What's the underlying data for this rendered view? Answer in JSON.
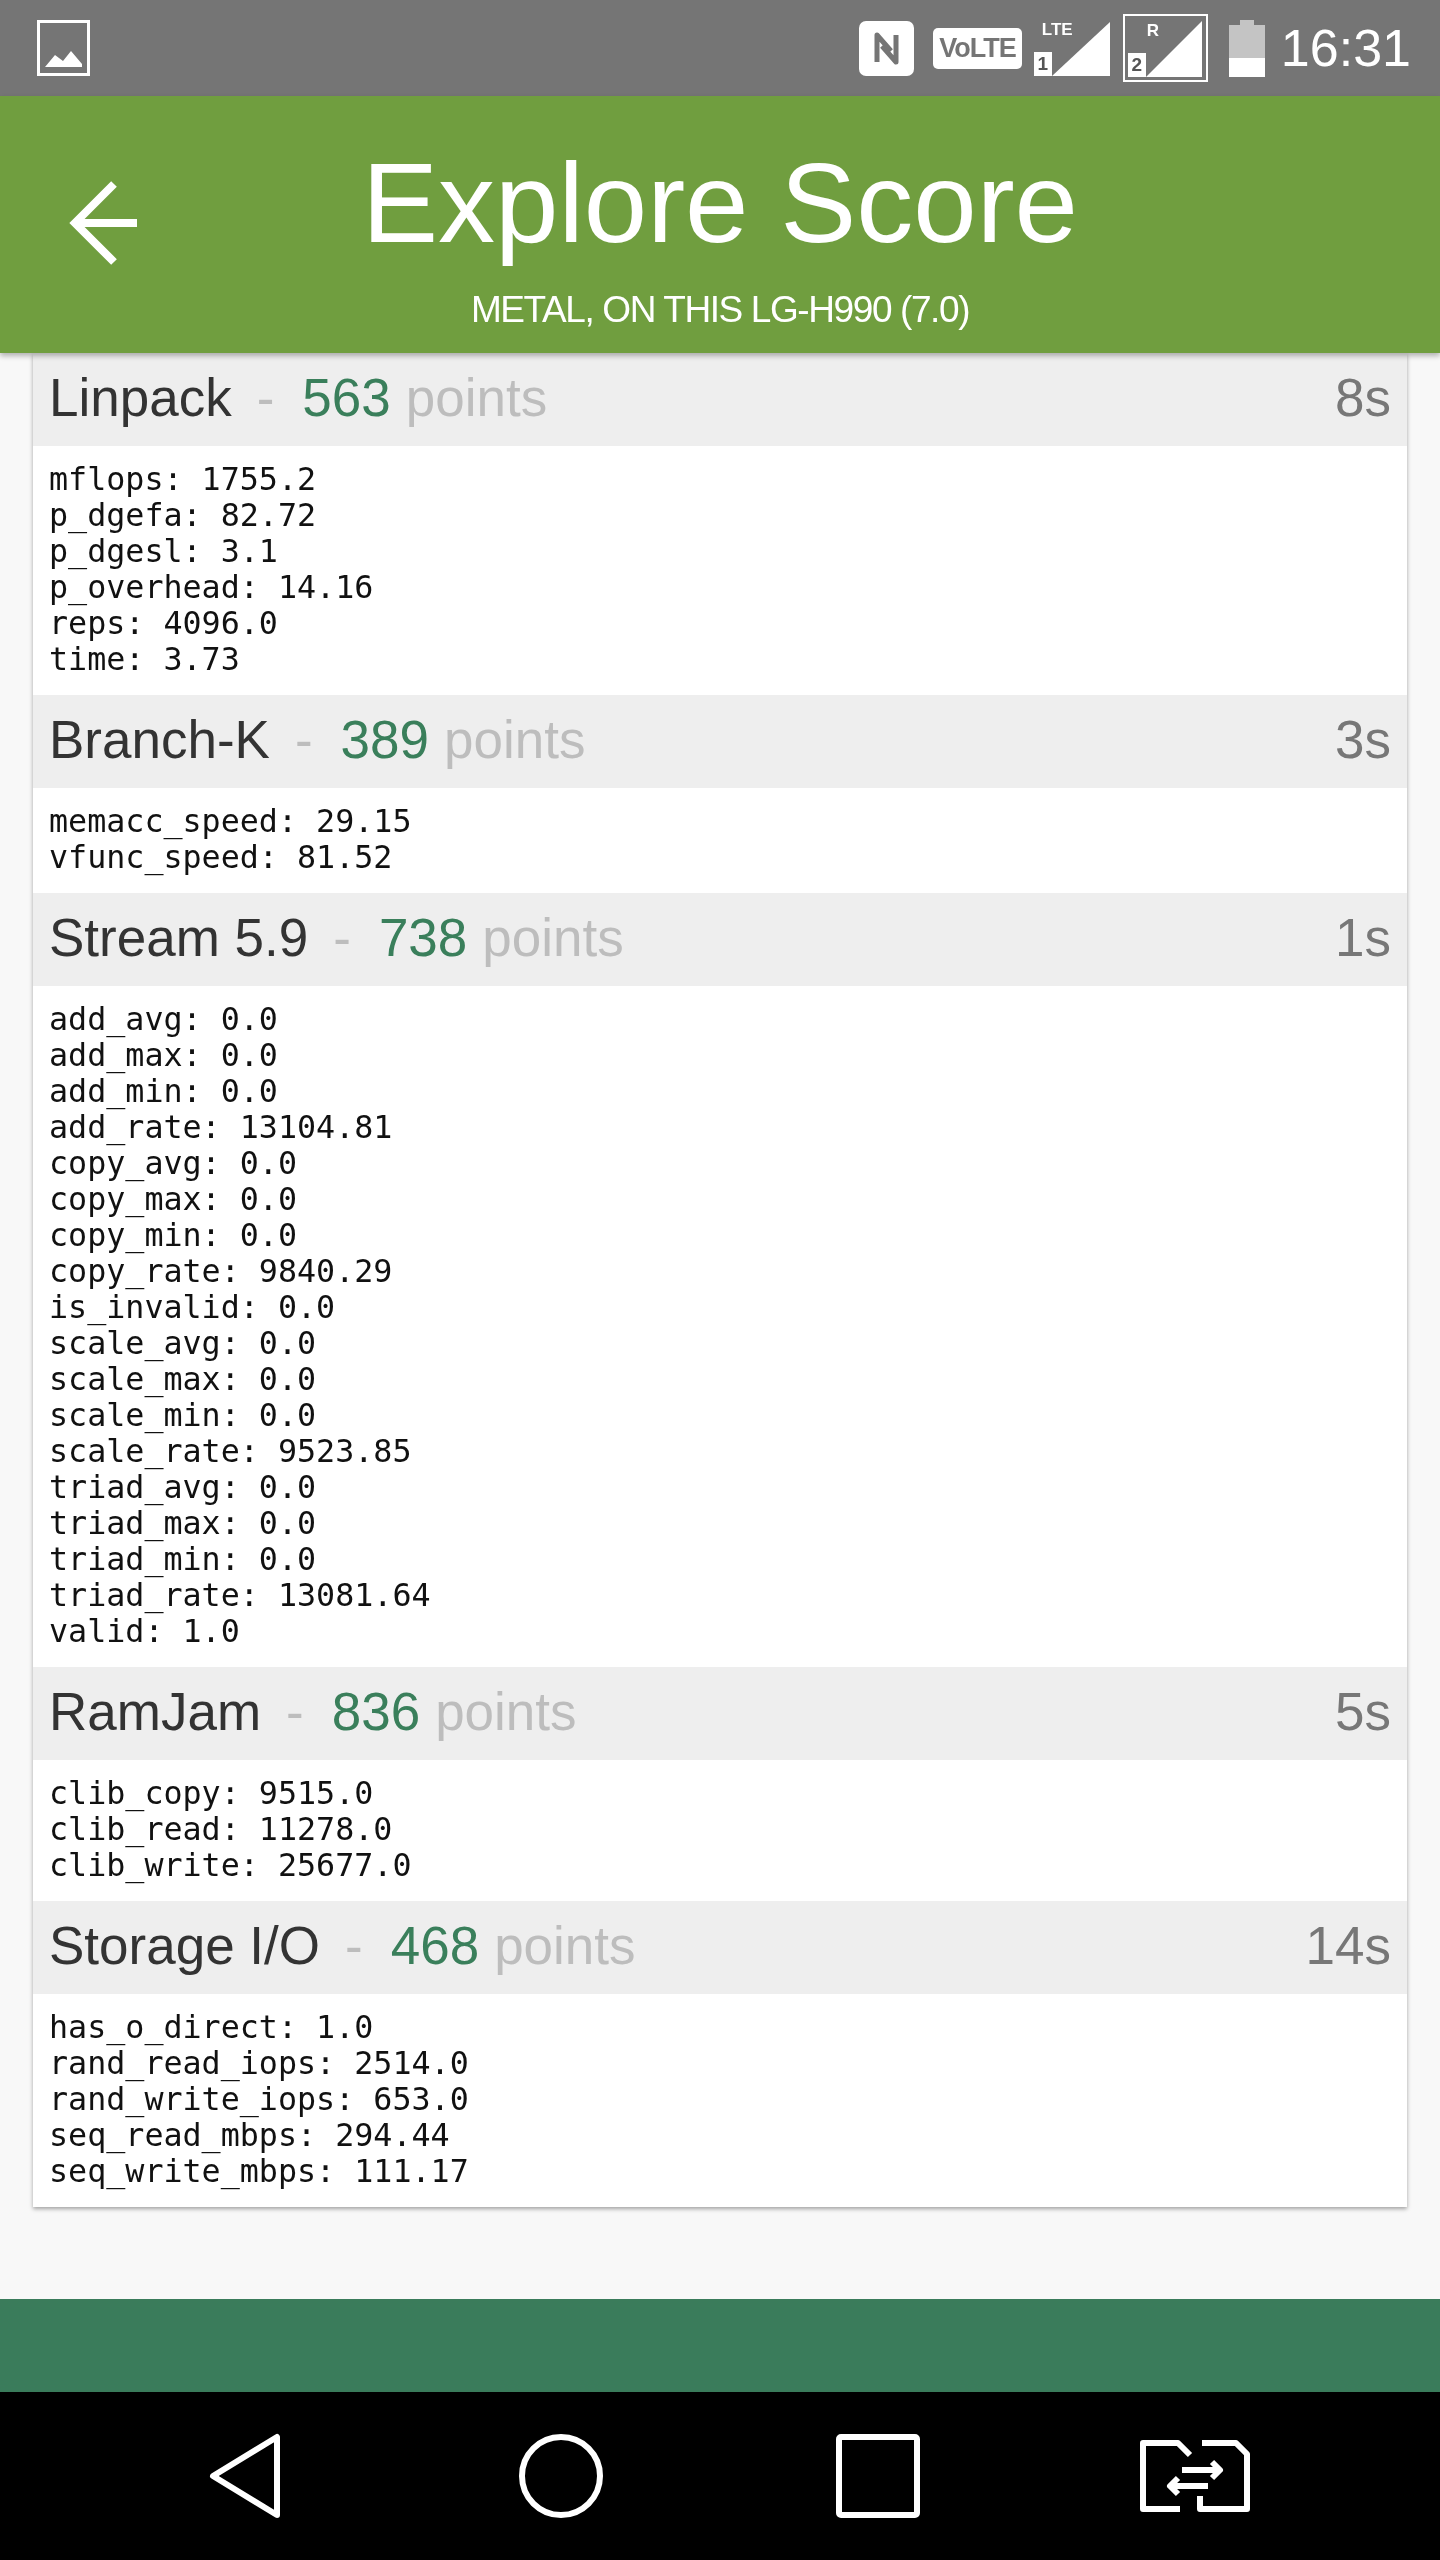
{
  "status_bar": {
    "volte": "VoLTE",
    "signals": [
      {
        "network": "LTE",
        "slot": "1",
        "framed": false
      },
      {
        "network": "R",
        "slot": "2",
        "framed": true
      }
    ],
    "time": "16:31"
  },
  "app_bar": {
    "title": "Explore Score",
    "subtitle": "METAL, ON THIS LG-H990 (7.0)"
  },
  "sections": [
    {
      "name": "Linpack",
      "separator": "-",
      "score": "563",
      "unit": "points",
      "duration": "8s",
      "lines": [
        "mflops: 1755.2",
        "p_dgefa: 82.72",
        "p_dgesl: 3.1",
        "p_overhead: 14.16",
        "reps: 4096.0",
        "time: 3.73"
      ]
    },
    {
      "name": "Branch-K",
      "separator": "-",
      "score": "389",
      "unit": "points",
      "duration": "3s",
      "lines": [
        "memacc_speed: 29.15",
        "vfunc_speed: 81.52"
      ]
    },
    {
      "name": "Stream 5.9",
      "separator": "-",
      "score": "738",
      "unit": "points",
      "duration": "1s",
      "lines": [
        "add_avg: 0.0",
        "add_max: 0.0",
        "add_min: 0.0",
        "add_rate: 13104.81",
        "copy_avg: 0.0",
        "copy_max: 0.0",
        "copy_min: 0.0",
        "copy_rate: 9840.29",
        "is_invalid: 0.0",
        "scale_avg: 0.0",
        "scale_max: 0.0",
        "scale_min: 0.0",
        "scale_rate: 9523.85",
        "triad_avg: 0.0",
        "triad_max: 0.0",
        "triad_min: 0.0",
        "triad_rate: 13081.64",
        "valid: 1.0"
      ]
    },
    {
      "name": "RamJam",
      "separator": "-",
      "score": "836",
      "unit": "points",
      "duration": "5s",
      "lines": [
        "clib_copy: 9515.0",
        "clib_read: 11278.0",
        "clib_write: 25677.0"
      ]
    },
    {
      "name": "Storage I/O",
      "separator": "-",
      "score": "468",
      "unit": "points",
      "duration": "14s",
      "lines": [
        "has_o_direct: 1.0",
        "rand_read_iops: 2514.0",
        "rand_write_iops: 653.0",
        "seq_read_mbps: 294.44",
        "seq_write_mbps: 111.17"
      ]
    }
  ]
}
